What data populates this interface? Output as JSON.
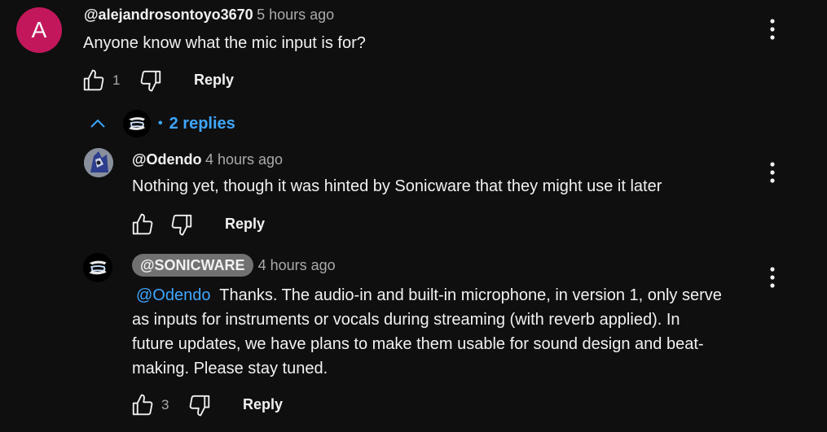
{
  "comment": {
    "avatar_letter": "A",
    "avatar_color": "#c2185b",
    "handle": "@alejandrosontoyo3670",
    "time": "5 hours ago",
    "text": "Anyone know what the mic input is for?",
    "like_count": "1",
    "reply_label": "Reply"
  },
  "replies_toggle": {
    "separator": "•",
    "label": "2 replies"
  },
  "replies": [
    {
      "handle": "@Odendo",
      "time": "4 hours ago",
      "text": "Nothing yet, though it was hinted by Sonicware that they might use it later",
      "like_count": "",
      "reply_label": "Reply"
    },
    {
      "handle": "@SONICWARE",
      "time": "4 hours ago",
      "mention": "@Odendo",
      "text_line1": "Thanks. The audio-in and built-in microphone, in version 1, only serve",
      "text_line2": "as inputs for instruments or vocals during streaming (with reverb applied). In",
      "text_line3": "future updates, we have plans to make them usable for sound design and beat-",
      "text_line4": "making. Please stay tuned.",
      "like_count": "3",
      "reply_label": "Reply"
    }
  ],
  "colors": {
    "background": "#0f0f0f",
    "link": "#3ea6ff",
    "muted": "#aaaaaa",
    "owner_badge": "#717171"
  },
  "icons": [
    "thumbs-up-icon",
    "thumbs-down-icon",
    "more-vert-icon",
    "chevron-up-icon",
    "avatar"
  ]
}
